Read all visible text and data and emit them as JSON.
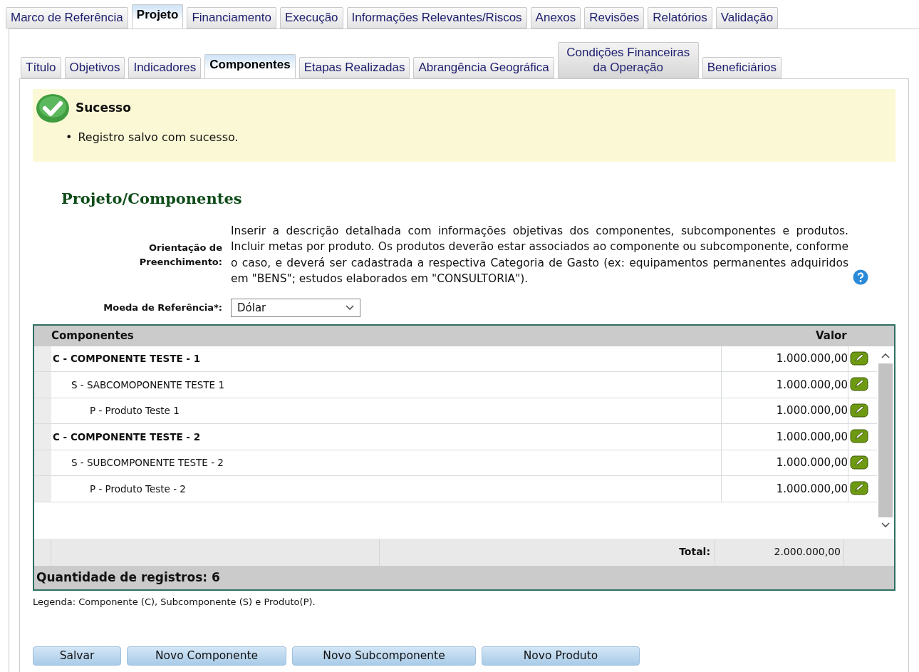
{
  "main_tabs": [
    {
      "label": "Marco de Referência",
      "selected": false
    },
    {
      "label": "Projeto",
      "selected": true
    },
    {
      "label": "Financiamento",
      "selected": false
    },
    {
      "label": "Execução",
      "selected": false
    },
    {
      "label": "Informações Relevantes/Riscos",
      "selected": false
    },
    {
      "label": "Anexos",
      "selected": false
    },
    {
      "label": "Revisões",
      "selected": false
    },
    {
      "label": "Relatórios",
      "selected": false
    },
    {
      "label": "Validação",
      "selected": false
    }
  ],
  "sub_tabs": [
    {
      "label": "Título",
      "selected": false
    },
    {
      "label": "Objetivos",
      "selected": false
    },
    {
      "label": "Indicadores",
      "selected": false
    },
    {
      "label": "Componentes",
      "selected": true
    },
    {
      "label": "Etapas Realizadas",
      "selected": false
    },
    {
      "label": "Abrangência Geográfica",
      "selected": false
    },
    {
      "label": "Condições Financeiras da Operação",
      "selected": false
    },
    {
      "label": "Beneficiários",
      "selected": false
    }
  ],
  "message": {
    "title": "Sucesso",
    "bullet": "•",
    "items": [
      "Registro salvo com sucesso."
    ]
  },
  "heading": "Projeto/Componentes",
  "guidance": {
    "label": "Orientação de Preenchimento:",
    "text": "Inserir a descrição detalhada com informações objetivas dos componentes, subcomponentes e produtos. Incluir metas por produto. Os produtos deverão estar associados ao componente ou subcomponente, conforme o caso, e deverá ser cadastrada a respectiva Categoria de Gasto (ex: equipamentos permanentes adquiridos em \"BENS\"; estudos elaborados em \"CONSULTORIA\")."
  },
  "currency": {
    "label": "Moeda de Referência*:",
    "value": "Dólar"
  },
  "table": {
    "columns": [
      "Componentes",
      "Valor"
    ],
    "rows": [
      {
        "name": "C - COMPONENTE TESTE - 1",
        "value": "1.000.000,00",
        "children": [
          {
            "name": "S - SABCOMOPONENTE TESTE 1",
            "value": "1.000.000,00",
            "children": [
              {
                "name": "P - Produto Teste 1",
                "value": "1.000.000,00"
              }
            ]
          }
        ]
      },
      {
        "name": "C - COMPONENTE TESTE - 2",
        "value": "1.000.000,00",
        "children": [
          {
            "name": "S - SUBCOMPONENTE TESTE - 2",
            "value": "1.000.000,00",
            "children": [
              {
                "name": "P - Produto Teste - 2",
                "value": "1.000.000,00"
              }
            ]
          }
        ]
      }
    ],
    "total_label": "Total:",
    "total_value": "2.000.000,00",
    "count": "Quantidade de registros: 6"
  },
  "legend": "Legenda: Componente (C), Subcomponente (S) e Produto(P).",
  "buttons": [
    "Salvar",
    "Novo Componente",
    "Novo Subcomponente",
    "Novo Produto"
  ]
}
